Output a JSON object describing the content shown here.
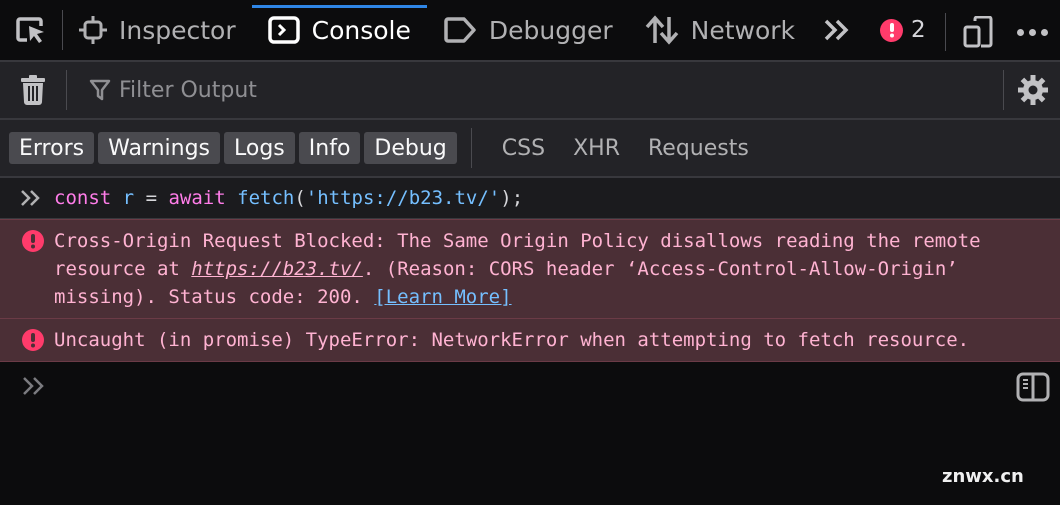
{
  "tabs": [
    {
      "id": "inspector",
      "label": "Inspector",
      "icon": "inspector-icon",
      "active": false
    },
    {
      "id": "console",
      "label": "Console",
      "icon": "console-icon",
      "active": true
    },
    {
      "id": "debugger",
      "label": "Debugger",
      "icon": "debugger-icon",
      "active": false
    },
    {
      "id": "network",
      "label": "Network",
      "icon": "network-icon",
      "active": false
    }
  ],
  "tabbar": {
    "error_count": "2",
    "accent_color": "#2f86e6",
    "error_color": "#ff3b6b"
  },
  "toolbar": {
    "filter_placeholder": "Filter Output",
    "filter_value": ""
  },
  "levels": {
    "buttons": [
      "Errors",
      "Warnings",
      "Logs",
      "Info",
      "Debug"
    ],
    "request_filters": [
      "CSS",
      "XHR",
      "Requests"
    ]
  },
  "console": {
    "command": {
      "kw1": "const",
      "var": "r",
      "eq": "=",
      "kw2": "await",
      "fn": "fetch",
      "open": "(",
      "str": "'https://b23.tv/'",
      "close": ");"
    },
    "messages": [
      {
        "level": "error",
        "text_before": "Cross-Origin Request Blocked: The Same Origin Policy disallows reading the remote resource at ",
        "url": "https://b23.tv/",
        "text_after": ". (Reason: CORS header ‘Access-Control-Allow-Origin’ missing). Status code: 200. ",
        "link": "[Learn More]"
      },
      {
        "level": "error",
        "text": "Uncaught (in promise) TypeError: NetworkError when attempting to fetch resource."
      }
    ]
  },
  "watermark": "znwx.cn"
}
